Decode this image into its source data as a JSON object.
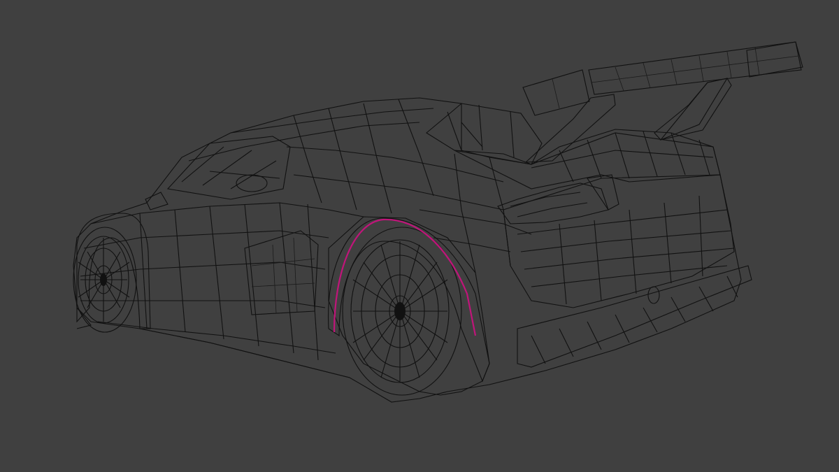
{
  "viewport": {
    "background_color": "#404040",
    "model_fill_color": "#9a9aa6",
    "wire_color": "#111111",
    "selected_edge_color": "#c0157a",
    "mode": "edit-mesh-wireframe"
  }
}
